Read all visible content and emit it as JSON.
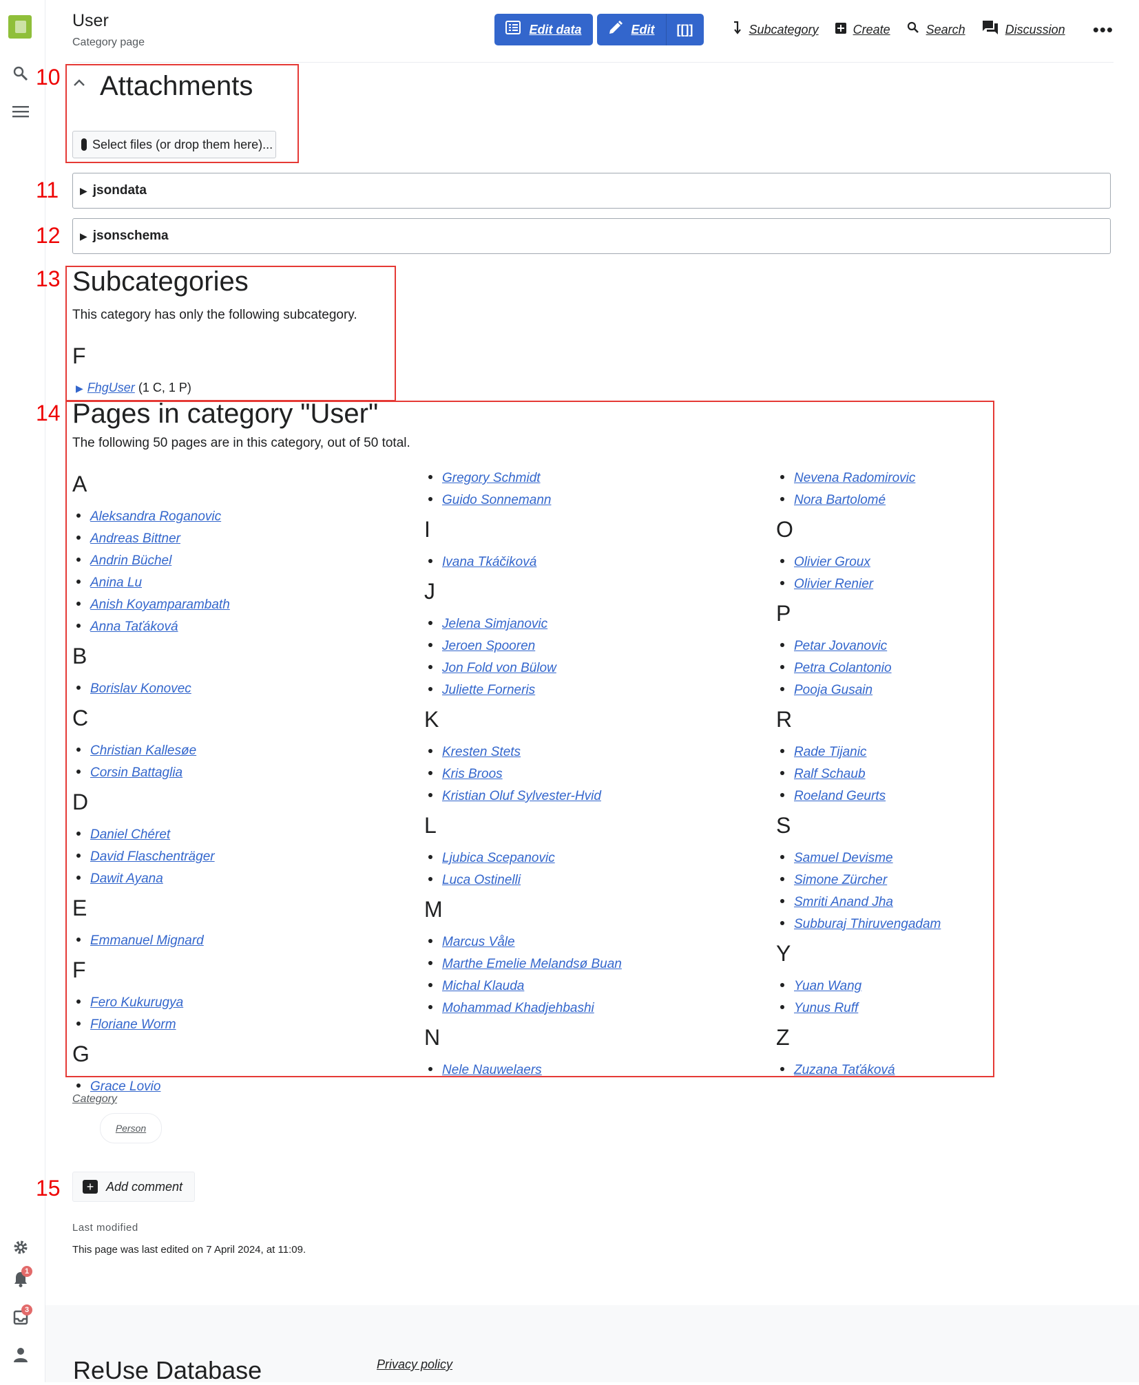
{
  "header": {
    "title": "User",
    "subtitle": "Category page",
    "actions": {
      "edit_data": "Edit data",
      "edit": "Edit",
      "wikitext": "[[]]",
      "subcategory": "Subcategory",
      "create": "Create",
      "search": "Search",
      "discussion": "Discussion",
      "more": "•••"
    }
  },
  "sidebar": {
    "notifications_count": "1",
    "inbox_count": "3"
  },
  "annotations": {
    "n10": "10",
    "n11": "11",
    "n12": "12",
    "n13": "13",
    "n14": "14",
    "n15": "15"
  },
  "attachments": {
    "title": "Attachments",
    "select_files": "Select files (or drop them here)..."
  },
  "panels": {
    "jsondata": "jsondata",
    "jsonschema": "jsonschema"
  },
  "subcategories": {
    "title": "Subcategories",
    "description": "This category has only the following subcategory.",
    "letter": "F",
    "link": "FhgUser",
    "counts": "(1 C, 1 P)"
  },
  "pages": {
    "title": "Pages in category \"User\"",
    "description": "The following 50 pages are in this category, out of 50 total.",
    "col1": [
      {
        "letter": "A",
        "items": [
          "Aleksandra Roganovic",
          "Andreas Bittner",
          "Andrin Büchel",
          "Anina Lu",
          "Anish Koyamparambath",
          "Anna Taťáková"
        ]
      },
      {
        "letter": "B",
        "items": [
          "Borislav Konovec"
        ]
      },
      {
        "letter": "C",
        "items": [
          "Christian Kallesøe",
          "Corsin Battaglia"
        ]
      },
      {
        "letter": "D",
        "items": [
          "Daniel Chéret",
          "David Flaschenträger",
          "Dawit Ayana"
        ]
      },
      {
        "letter": "E",
        "items": [
          "Emmanuel Mignard"
        ]
      },
      {
        "letter": "F",
        "items": [
          "Fero Kukurugya",
          "Floriane Worm"
        ]
      },
      {
        "letter": "G",
        "items": [
          "Grace Lovio"
        ]
      }
    ],
    "col2": [
      {
        "letter": "",
        "items": [
          "Gregory Schmidt",
          "Guido Sonnemann"
        ]
      },
      {
        "letter": "I",
        "items": [
          "Ivana Tkáčiková"
        ]
      },
      {
        "letter": "J",
        "items": [
          "Jelena Simjanovic",
          "Jeroen Spooren",
          "Jon Fold von Bülow",
          "Juliette Forneris"
        ]
      },
      {
        "letter": "K",
        "items": [
          "Kresten Stets",
          "Kris Broos",
          "Kristian Oluf Sylvester-Hvid"
        ]
      },
      {
        "letter": "L",
        "items": [
          "Ljubica Scepanovic",
          "Luca Ostinelli"
        ]
      },
      {
        "letter": "M",
        "items": [
          "Marcus Våle",
          "Marthe Emelie Melandsø Buan",
          "Michal Klauda",
          "Mohammad Khadjehbashi"
        ]
      },
      {
        "letter": "N",
        "items": [
          "Nele Nauwelaers"
        ]
      }
    ],
    "col3": [
      {
        "letter": "",
        "items": [
          "Nevena Radomirovic",
          "Nora Bartolomé"
        ]
      },
      {
        "letter": "O",
        "items": [
          "Olivier Groux",
          "Olivier Renier"
        ]
      },
      {
        "letter": "P",
        "items": [
          "Petar Jovanovic",
          "Petra Colantonio",
          "Pooja Gusain"
        ]
      },
      {
        "letter": "R",
        "items": [
          "Rade Tijanic",
          "Ralf Schaub",
          "Roeland Geurts"
        ]
      },
      {
        "letter": "S",
        "items": [
          "Samuel Devisme",
          "Simone Zürcher",
          "Smriti Anand Jha",
          "Subburaj Thiruvengadam"
        ]
      },
      {
        "letter": "Y",
        "items": [
          "Yuan Wang",
          "Yunus Ruff"
        ]
      },
      {
        "letter": "Z",
        "items": [
          "Zuzana Taťáková"
        ]
      }
    ]
  },
  "categories": {
    "label": "Category",
    "items": [
      "Person"
    ]
  },
  "comments": {
    "add": "Add comment"
  },
  "last_modified": {
    "heading": "Last modified",
    "text": "This page was last edited on 7 April 2024, at 11:09."
  },
  "footer": {
    "site": "ReUse Database",
    "privacy": "Privacy policy"
  }
}
